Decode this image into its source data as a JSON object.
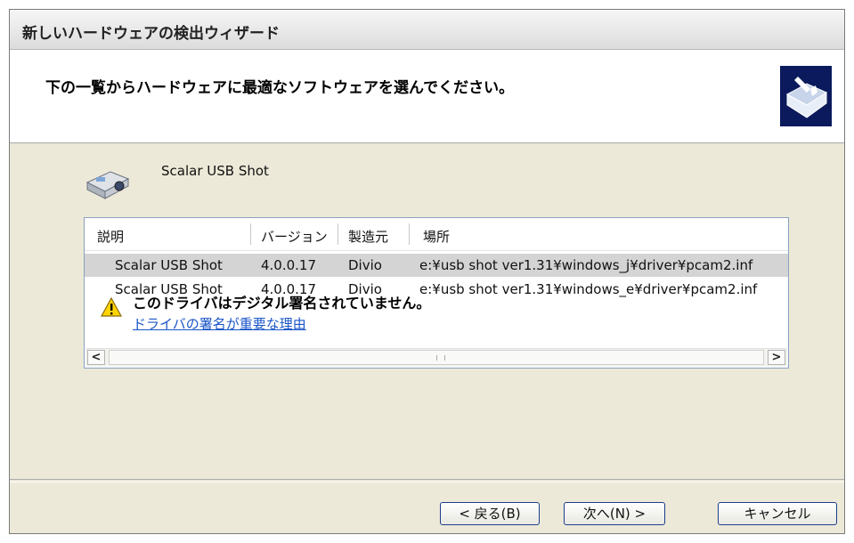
{
  "window": {
    "title": "新しいハードウェアの検出ウィザード"
  },
  "header": {
    "heading": "下の一覧からハードウェアに最適なソフトウェアを選んでください。"
  },
  "device": {
    "name": "Scalar USB Shot"
  },
  "list": {
    "columns": [
      "説明",
      "バージョン",
      "製造元",
      "場所"
    ],
    "rows": [
      {
        "description": "Scalar USB Shot",
        "version": "4.0.0.17",
        "manufacturer": "Divio",
        "location": "e:¥usb shot ver1.31¥windows_j¥driver¥pcam2.inf",
        "selected": true
      },
      {
        "description": "Scalar USB Shot",
        "version": "4.0.0.17",
        "manufacturer": "Divio",
        "location": "e:¥usb shot ver1.31¥windows_e¥driver¥pcam2.inf",
        "selected": false
      }
    ],
    "scroll_left": "<",
    "scroll_right": ">"
  },
  "warning": {
    "text": "このドライバはデジタル署名されていません。",
    "link": "ドライバの署名が重要な理由"
  },
  "buttons": {
    "back": "< 戻る(B)",
    "next": "次へ(N) >",
    "cancel": "キャンセル"
  },
  "colors": {
    "selected_row": "#d4d4d4",
    "link": "#1a55c8",
    "panel": "#ece9d8"
  }
}
